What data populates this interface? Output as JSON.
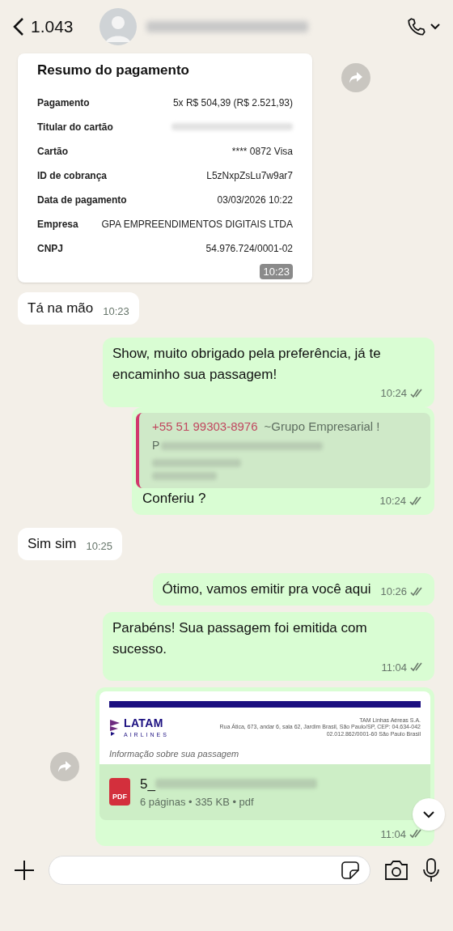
{
  "header": {
    "back_count": "1.043"
  },
  "messages": [
    {
      "kind": "receipt",
      "outgoing": false,
      "forward": true,
      "title": "Resumo do pagamento",
      "time": "10:23",
      "rows": [
        {
          "label": "Pagamento",
          "value": "5x R$ 504,39 (R$ 2.521,93)",
          "blurred": false
        },
        {
          "label": "Titular do cartão",
          "blurred": true
        },
        {
          "label": "Cartão",
          "value": "**** 0872 Visa",
          "blurred": false
        },
        {
          "label": "ID de cobrança",
          "value": "L5zNxpZsLu7w9ar7",
          "blurred": false
        },
        {
          "label": "Data de pagamento",
          "value": "03/03/2026 10:22",
          "blurred": false
        },
        {
          "label": "Empresa",
          "value": "GPA EMPREENDIMENTOS DIGITAIS LTDA",
          "blurred": false
        },
        {
          "label": "CNPJ",
          "value": "54.976.724/0001-02",
          "blurred": false
        }
      ]
    },
    {
      "kind": "text",
      "outgoing": false,
      "text": "Tá na mão",
      "time": "10:23"
    },
    {
      "kind": "text",
      "outgoing": true,
      "text": "Show, muito obrigado pela preferência, já te encaminho sua passagem!",
      "time": "10:24",
      "read": false
    },
    {
      "kind": "quote",
      "outgoing": true,
      "quote_author": "+55 51 99303-8976",
      "quote_group": "~Grupo Empresarial !",
      "quote_first_letter": "P",
      "text": "Conferiu ?",
      "time": "10:24",
      "read": false
    },
    {
      "kind": "text",
      "outgoing": false,
      "text": "Sim sim",
      "time": "10:25"
    },
    {
      "kind": "text",
      "outgoing": true,
      "text": "Ótimo, vamos emitir pra você aqui",
      "time": "10:26",
      "read": false
    },
    {
      "kind": "text",
      "outgoing": true,
      "text": "Parabéns! Sua passagem foi emitida com sucesso.",
      "time": "11:04",
      "read": false
    },
    {
      "kind": "document",
      "outgoing": true,
      "forward": true,
      "preview": {
        "brand": "LATAM",
        "brand_sub": "AIRLINES",
        "company": "TAM Linhas Aéreas S.A.",
        "address": "Rua Ática, 673, andar 6, sala 62, Jardim Brasil, São Paulo/SP, CEP: 04.634-042 02.012.862/0001-60 São Paulo Brasil",
        "heading": "Informação sobre sua passagem"
      },
      "file_badge": "PDF",
      "file_name": "5_",
      "file_meta": "6 páginas • 335 KB • pdf",
      "time": "11:04",
      "read": false
    }
  ]
}
